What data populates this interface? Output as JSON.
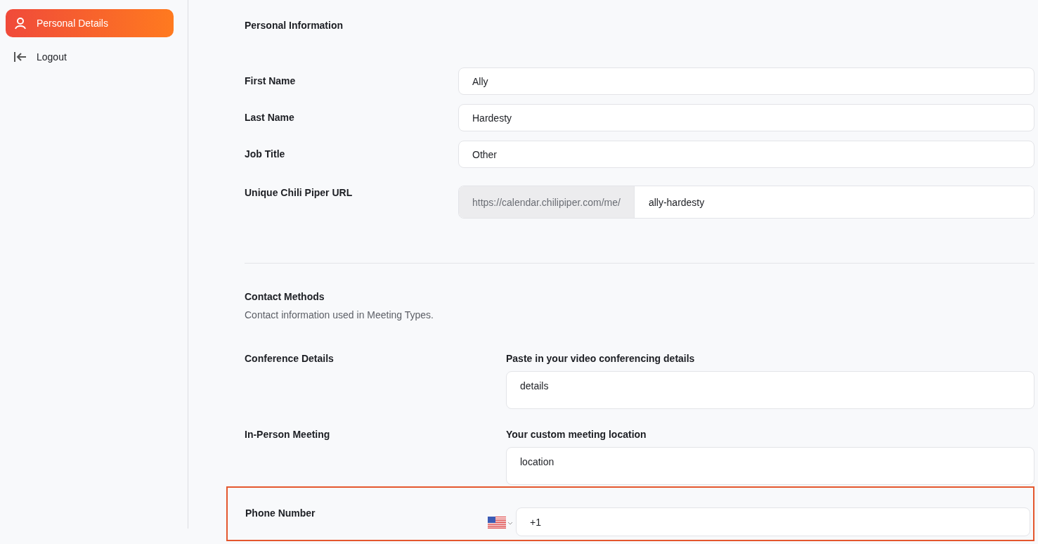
{
  "sidebar": {
    "items": [
      {
        "label": "Personal Details",
        "selected": true
      },
      {
        "label": "Logout",
        "selected": false
      }
    ]
  },
  "personal": {
    "title": "Personal Information",
    "fields": [
      {
        "label": "First Name",
        "value": "Ally"
      },
      {
        "label": "Last Name",
        "value": "Hardesty"
      },
      {
        "label": "Job Title",
        "value": "Other"
      }
    ],
    "url": {
      "label": "Unique Chili Piper URL",
      "prefix": "https://calendar.chilipiper.com/me/",
      "value": "ally-hardesty"
    }
  },
  "contact": {
    "title": "Contact Methods",
    "description": "Contact information used in Meeting Types.",
    "methods": [
      {
        "label": "Conference Details",
        "heading": "Paste in your video conferencing details",
        "value": "details"
      },
      {
        "label": "In-Person Meeting",
        "heading": "Your custom meeting location",
        "value": "location"
      }
    ],
    "phone": {
      "label": "Phone Number",
      "value": "+1",
      "highlighted": true
    }
  }
}
